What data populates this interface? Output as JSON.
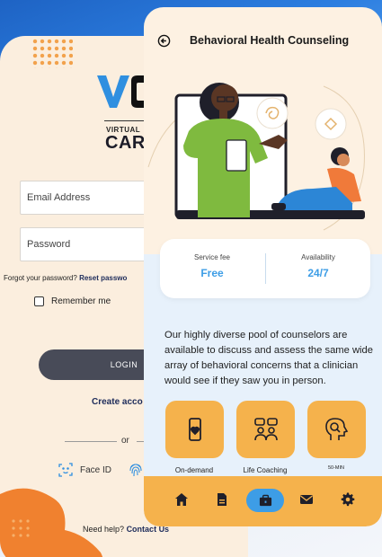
{
  "login": {
    "brand_small": "VIRTUAL",
    "brand_big": "CAR",
    "email_placeholder": "Email Address",
    "password_placeholder": "Password",
    "forgot_text": "Forgot your password?",
    "forgot_link": "Reset passwo",
    "remember_label": "Remember me",
    "login_button": "LOGIN",
    "create_account": "Create acco",
    "or_text": "or",
    "face_id_label": "Face ID",
    "help_text": "Need help?",
    "help_link": "Contact Us"
  },
  "counseling": {
    "title": "Behavioral Health Counseling",
    "service_fee_label": "Service fee",
    "service_fee_value": "Free",
    "availability_label": "Availability",
    "availability_value": "24/7",
    "description": "Our highly diverse pool of counselors are available to discuss and assess the same wide array of behavioral concerns that a clinician would see if they saw you in person.",
    "services": [
      {
        "label": "On-demand",
        "icon": "phone-heart-icon"
      },
      {
        "label": "Life Coaching",
        "icon": "people-chat-icon"
      },
      {
        "label": "50-MIN",
        "icon": "head-search-icon"
      }
    ],
    "nav": [
      "home-icon",
      "document-icon",
      "briefcase-icon",
      "mail-icon",
      "gear-icon"
    ]
  },
  "colors": {
    "accent_orange": "#f5b24c",
    "accent_blue": "#3d9de6",
    "dark_navy": "#1d2b5a"
  }
}
